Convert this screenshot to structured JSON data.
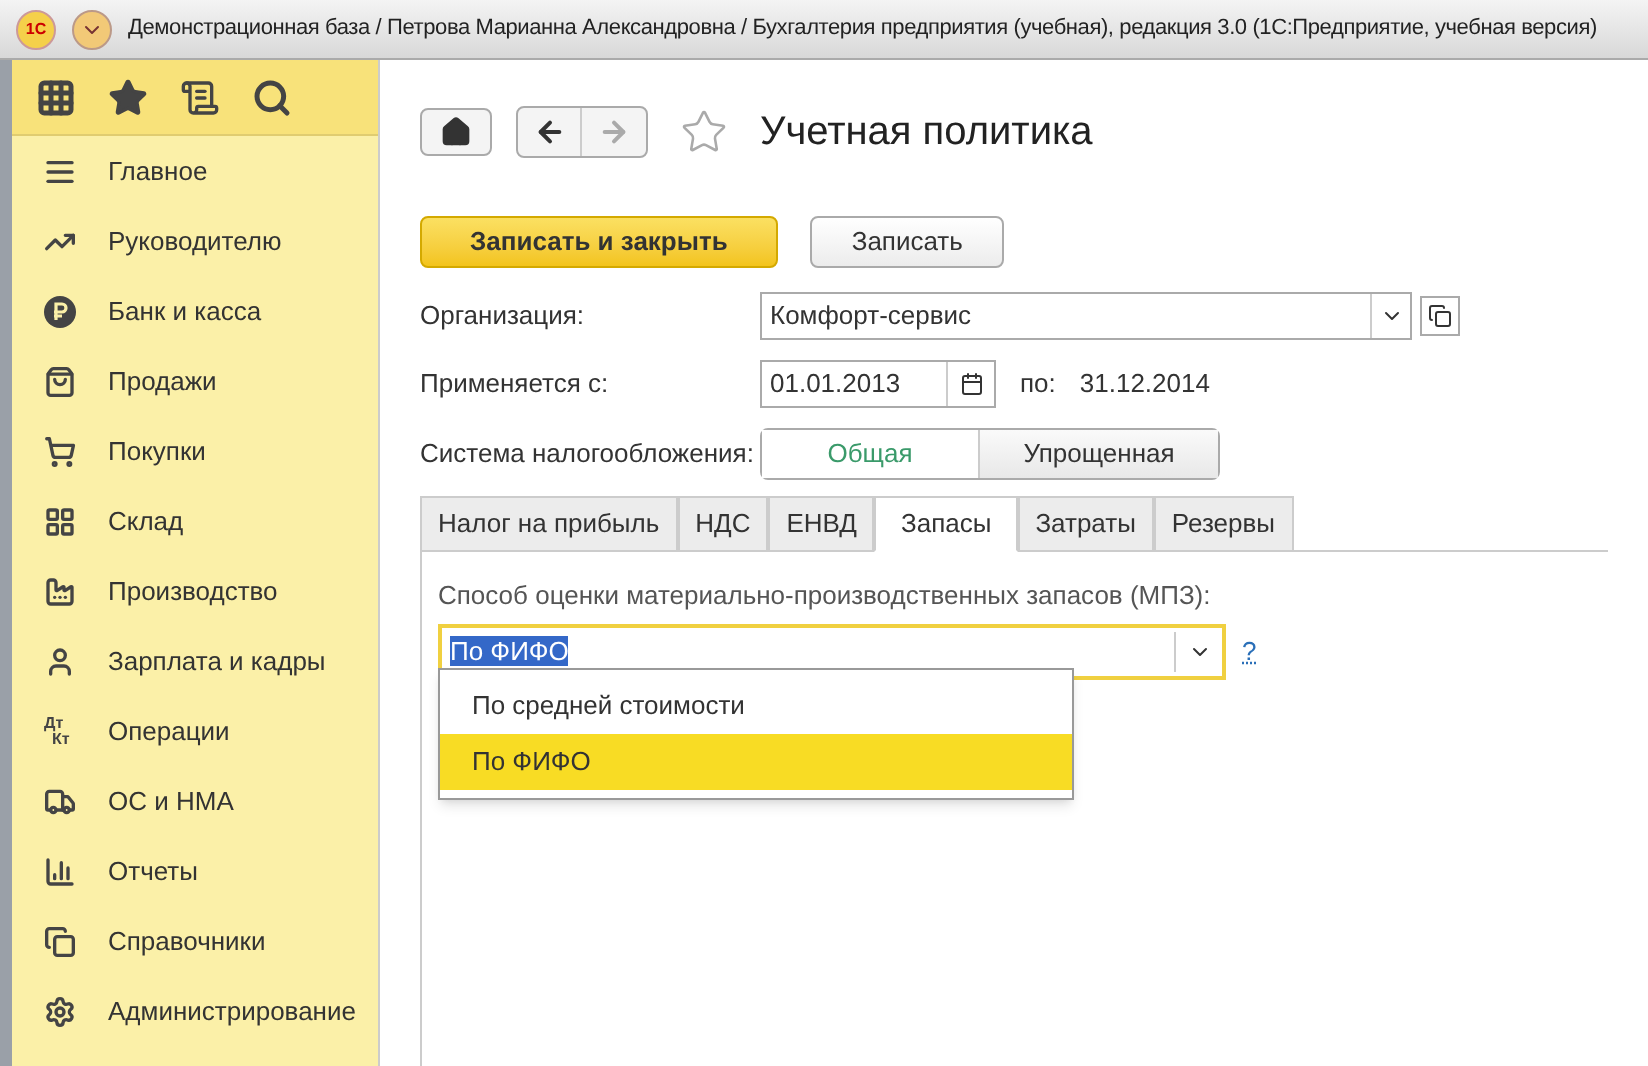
{
  "window": {
    "title": "Демонстрационная база / Петрова Марианна Александровна / Бухгалтерия предприятия (учебная), редакция 3.0  (1С:Предприятие, учебная версия)",
    "logo": "1С"
  },
  "sidebar": {
    "items": [
      {
        "label": "Главное",
        "selected": false
      },
      {
        "label": "Руководителю",
        "selected": false
      },
      {
        "label": "Банк и касса",
        "selected": false
      },
      {
        "label": "Продажи",
        "selected": false
      },
      {
        "label": "Покупки",
        "selected": false
      },
      {
        "label": "Склад",
        "selected": false
      },
      {
        "label": "Производство",
        "selected": false
      },
      {
        "label": "Зарплата и кадры",
        "selected": false
      },
      {
        "label": "Операции",
        "selected": false,
        "icon_text": [
          "Дт",
          "Кт"
        ]
      },
      {
        "label": "ОС и НМА",
        "selected": false
      },
      {
        "label": "Отчеты",
        "selected": false
      },
      {
        "label": "Справочники",
        "selected": false
      },
      {
        "label": "Администрирование",
        "selected": false
      }
    ]
  },
  "form": {
    "title": "Учетная политика",
    "favorite": false,
    "buttons": [
      {
        "label": "Записать и закрыть",
        "kind": "primary"
      },
      {
        "label": "Записать",
        "kind": "default"
      }
    ],
    "organization": {
      "label": "Организация:",
      "value": "Комфорт-сервис"
    },
    "period": {
      "label": "Применяется с:",
      "from": "01.01.2013",
      "to_label": "по:",
      "to": "31.12.2014"
    },
    "tax_system": {
      "label": "Система налогообложения:",
      "options": [
        {
          "label": "Общая",
          "selected": true
        },
        {
          "label": "Упрощенная",
          "selected": false
        }
      ]
    },
    "tabs": [
      {
        "label": "Налог на прибыль",
        "selected": false
      },
      {
        "label": "НДС",
        "selected": false
      },
      {
        "label": "ЕНВД",
        "selected": false
      },
      {
        "label": "Запасы",
        "selected": true
      },
      {
        "label": "Затраты",
        "selected": false
      },
      {
        "label": "Резервы",
        "selected": false
      }
    ],
    "inventory": {
      "label": "Способ оценки материально-производственных запасов (МПЗ):",
      "value": "По ФИФО",
      "help": "?",
      "options": [
        {
          "label": "По средней стоимости",
          "selected": false
        },
        {
          "label": "По ФИФО",
          "selected": true
        }
      ]
    }
  }
}
